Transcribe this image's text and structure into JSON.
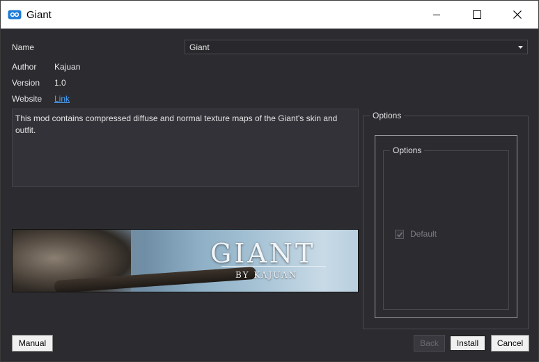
{
  "window": {
    "title": "Giant",
    "app_icon": "mod-organizer-icon",
    "controls": [
      "minimize-icon",
      "maximize-icon",
      "close-icon"
    ]
  },
  "info": {
    "name_label": "Name",
    "name_value": "Giant",
    "author_label": "Author",
    "author_value": "Kajuan",
    "version_label": "Version",
    "version_value": "1.0",
    "website_label": "Website",
    "website_link": "Link",
    "description": "This mod contains compressed diffuse and normal texture maps of the Giant's skin and outfit."
  },
  "banner": {
    "title": "GIANT",
    "subtitle": "BY KAJUAN"
  },
  "options": {
    "outer_title": "Options",
    "inner_title": "Options",
    "items": [
      {
        "label": "Default",
        "checked": true,
        "enabled": false
      }
    ]
  },
  "buttons": {
    "manual": "Manual",
    "back": "Back",
    "install": "Install",
    "cancel": "Cancel"
  },
  "colors": {
    "background": "#2b2b30",
    "link": "#4aa3ff",
    "titlebar": "#ffffff"
  }
}
